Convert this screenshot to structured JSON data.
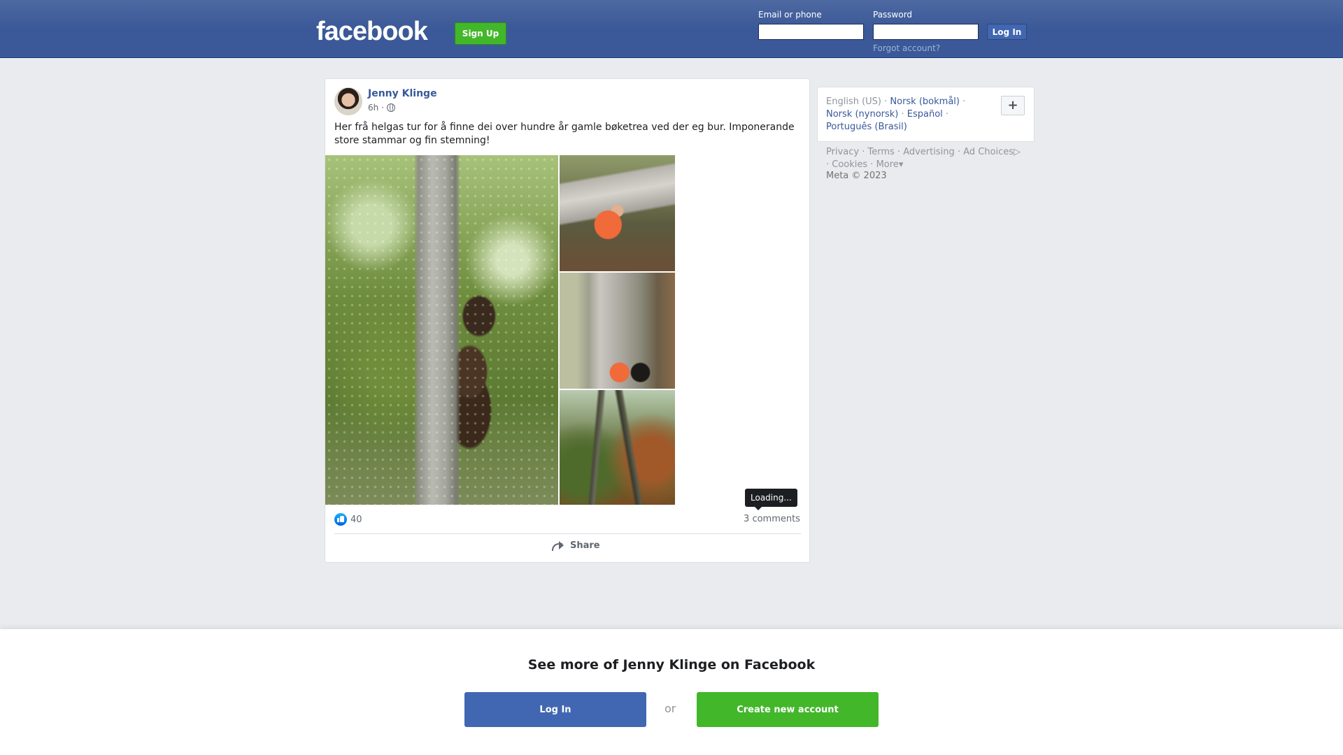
{
  "header": {
    "logo": "facebook",
    "signup_label": "Sign Up",
    "email_label": "Email or phone",
    "email_value": "",
    "password_label": "Password",
    "password_value": "",
    "login_label": "Log In",
    "forgot_label": "Forgot account?"
  },
  "post": {
    "author": "Jenny Klinge",
    "time": "6h",
    "separator": "·",
    "privacy_icon": "globe-icon",
    "text": "Her frå helgas tur for å finne dei over hundre år gamle bøketrea ved der eg bur. Imponerande store stammar og fin stemning!",
    "photos": [
      {
        "name": "photo-tall-beech-trunk"
      },
      {
        "name": "photo-woman-under-branch"
      },
      {
        "name": "photo-woman-at-trunk-with-dog"
      },
      {
        "name": "photo-forest-canopy"
      }
    ],
    "tooltip": "Loading...",
    "likes_count": "40",
    "comments_label": "3 comments",
    "share_label": "Share"
  },
  "sidebar": {
    "languages": {
      "current": "English (US)",
      "links": [
        "Norsk (bokmål)",
        "Norsk (nynorsk)",
        "Español",
        "Português (Brasil)"
      ],
      "plus": "+"
    },
    "footer_links": [
      "Privacy",
      "Terms",
      "Advertising",
      "Ad Choices",
      "Cookies",
      "More"
    ],
    "copyright": "Meta © 2023"
  },
  "banner": {
    "title": "See more of Jenny Klinge on Facebook",
    "login_label": "Log In",
    "or_label": "or",
    "create_label": "Create new account"
  },
  "colors": {
    "brand_blue": "#3b5998",
    "button_blue": "#4267b2",
    "signup_green": "#42b72a",
    "link_blue": "#385898"
  }
}
